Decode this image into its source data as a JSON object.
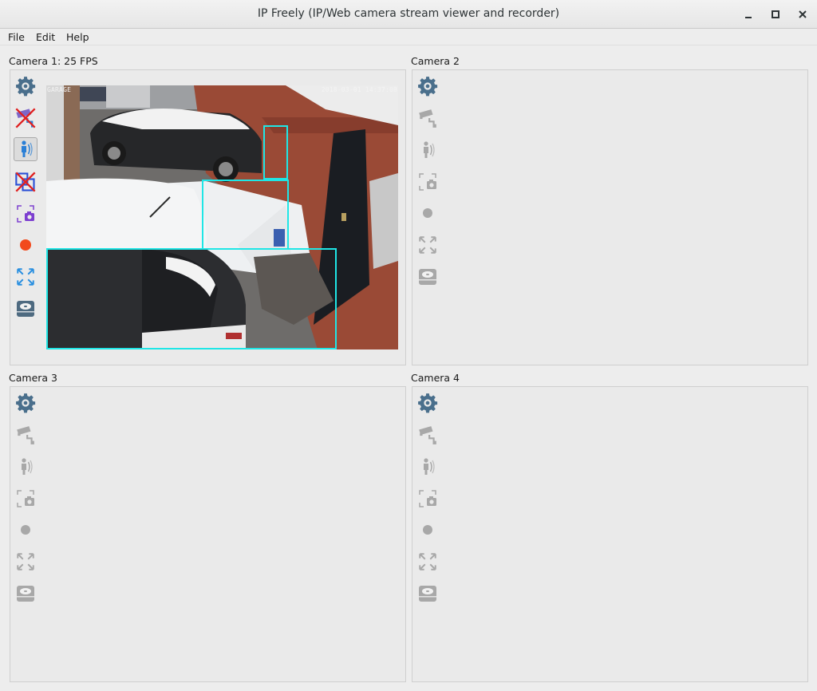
{
  "window": {
    "title": "IP Freely (IP/Web camera stream viewer and recorder)",
    "controls": [
      "minimize",
      "maximize",
      "close"
    ]
  },
  "menu": {
    "items": [
      "File",
      "Edit",
      "Help"
    ]
  },
  "cameras": [
    {
      "label": "Camera 1: 25 FPS",
      "streaming": true,
      "osd_left": "GARAGE",
      "osd_right": "2018-03-01 14:37:08",
      "toolbar": [
        "settings-icon",
        "camera-disabled-icon",
        "motion-detection-icon",
        "zones-disabled-icon",
        "snapshot-icon",
        "record-icon",
        "fullscreen-icon",
        "storage-icon"
      ]
    },
    {
      "label": "Camera 2",
      "streaming": false,
      "toolbar": [
        "settings-icon",
        "camera-icon",
        "motion-detection-icon",
        "snapshot-icon",
        "record-icon",
        "fullscreen-icon",
        "storage-icon"
      ]
    },
    {
      "label": "Camera 3",
      "streaming": false,
      "toolbar": [
        "settings-icon",
        "camera-icon",
        "motion-detection-icon",
        "snapshot-icon",
        "record-icon",
        "fullscreen-icon",
        "storage-icon"
      ]
    },
    {
      "label": "Camera 4",
      "streaming": false,
      "toolbar": [
        "settings-icon",
        "camera-icon",
        "motion-detection-icon",
        "snapshot-icon",
        "record-icon",
        "fullscreen-icon",
        "storage-icon"
      ]
    }
  ],
  "colors": {
    "zone_outline": "#1fe6e6",
    "record_active": "#f24a1d",
    "icon_active_blue": "#2a7fd6",
    "icon_disabled": "#a8a8a8"
  }
}
